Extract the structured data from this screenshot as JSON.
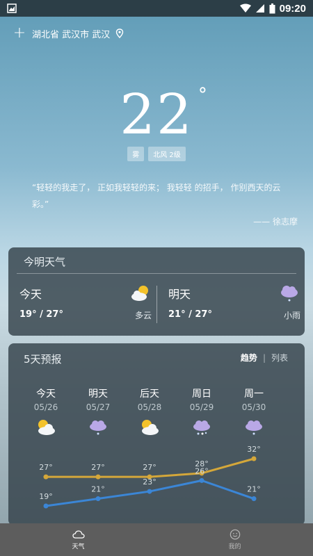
{
  "status_bar": {
    "time": "09:20"
  },
  "location": {
    "text": "湖北省 武汉市 武汉"
  },
  "current": {
    "temperature": "22",
    "unit": "°",
    "badges": [
      "雾",
      "北风 2级"
    ]
  },
  "quote": {
    "text": "“轻轻的我走了， 正如我轻轻的来； 我轻轻 的招手， 作别西天的云彩。”",
    "author": "—— 徐志摩"
  },
  "today_card": {
    "title": "今明天气",
    "today": {
      "label": "今天",
      "temps": "19° / 27°",
      "condition": "多云",
      "icon": "partly-cloudy-icon"
    },
    "tomorrow": {
      "label": "明天",
      "temps": "21° / 27°",
      "condition": "小雨",
      "icon": "light-rain-icon"
    }
  },
  "forecast": {
    "title": "5天预报",
    "tabs": {
      "active": "趋势",
      "inactive": "列表"
    },
    "days": [
      {
        "name": "今天",
        "date": "05/26",
        "icon": "partly-cloudy-icon"
      },
      {
        "name": "明天",
        "date": "05/27",
        "icon": "light-rain-icon"
      },
      {
        "name": "后天",
        "date": "05/28",
        "icon": "partly-cloudy-icon"
      },
      {
        "name": "周日",
        "date": "05/29",
        "icon": "snow-rain-icon"
      },
      {
        "name": "周一",
        "date": "05/30",
        "icon": "light-rain-icon"
      }
    ]
  },
  "chart_data": {
    "type": "line",
    "categories": [
      "05/26",
      "05/27",
      "05/28",
      "05/29",
      "05/30"
    ],
    "series": [
      {
        "values": [
          27,
          27,
          27,
          28,
          32
        ],
        "color": "#d4a73a",
        "labels": [
          "27°",
          "27°",
          "27°",
          "28°",
          "32°"
        ]
      },
      {
        "values": [
          19,
          21,
          23,
          26,
          21
        ],
        "color": "#3b86d6",
        "labels": [
          "19°",
          "21°",
          "23°",
          "26°",
          "21°"
        ]
      }
    ]
  },
  "bottom_nav": [
    {
      "label": "天气",
      "icon": "weather-cloud-icon",
      "active": true
    },
    {
      "label": "我的",
      "icon": "smiley-icon",
      "active": false
    }
  ]
}
